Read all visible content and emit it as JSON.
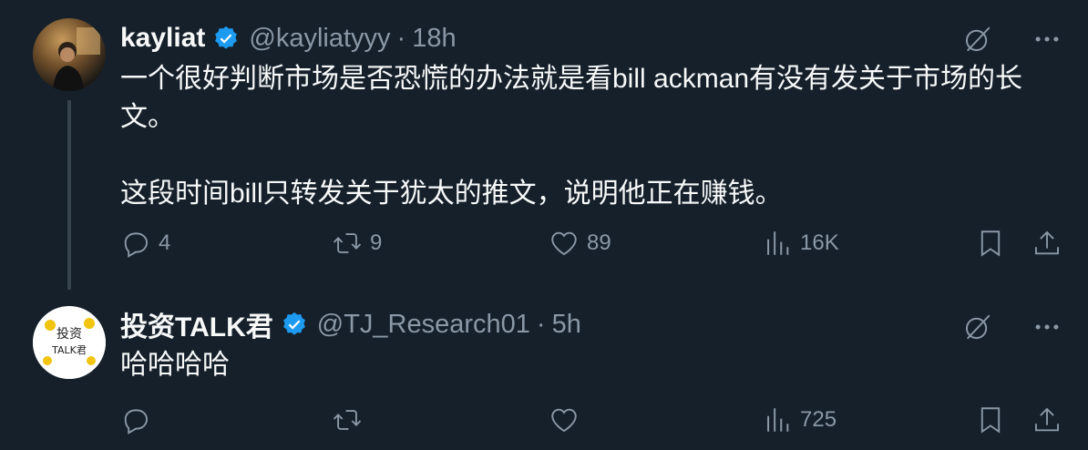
{
  "tweets": [
    {
      "display_name": "kayliat",
      "handle": "@kayliatyyy",
      "dot": "·",
      "time": "18h",
      "text": [
        "一个很好判断市场是否恐慌的办法就是看bill ackman有没有发关于市场的长文。",
        "这段时间bill只转发关于犹太的推文，说明他正在赚钱。"
      ],
      "stats": {
        "replies": "4",
        "retweets": "9",
        "likes": "89",
        "views": "16K"
      }
    },
    {
      "display_name": "投资TALK君",
      "handle": "@TJ_Research01",
      "dot": "·",
      "time": "5h",
      "text": [
        "哈哈哈哈"
      ],
      "avatar_text_1": "投资",
      "avatar_text_2": "TALK君",
      "stats": {
        "replies": "",
        "retweets": "",
        "likes": "",
        "views": "725"
      }
    }
  ],
  "colors": {
    "background": "#15202b",
    "text": "#f7f9f9",
    "muted": "#8b98a5",
    "verified": "#1d9bf0"
  },
  "icons": [
    "grok-icon",
    "more-icon",
    "reply-icon",
    "retweet-icon",
    "like-icon",
    "views-icon",
    "bookmark-icon",
    "share-icon",
    "verified-icon"
  ]
}
